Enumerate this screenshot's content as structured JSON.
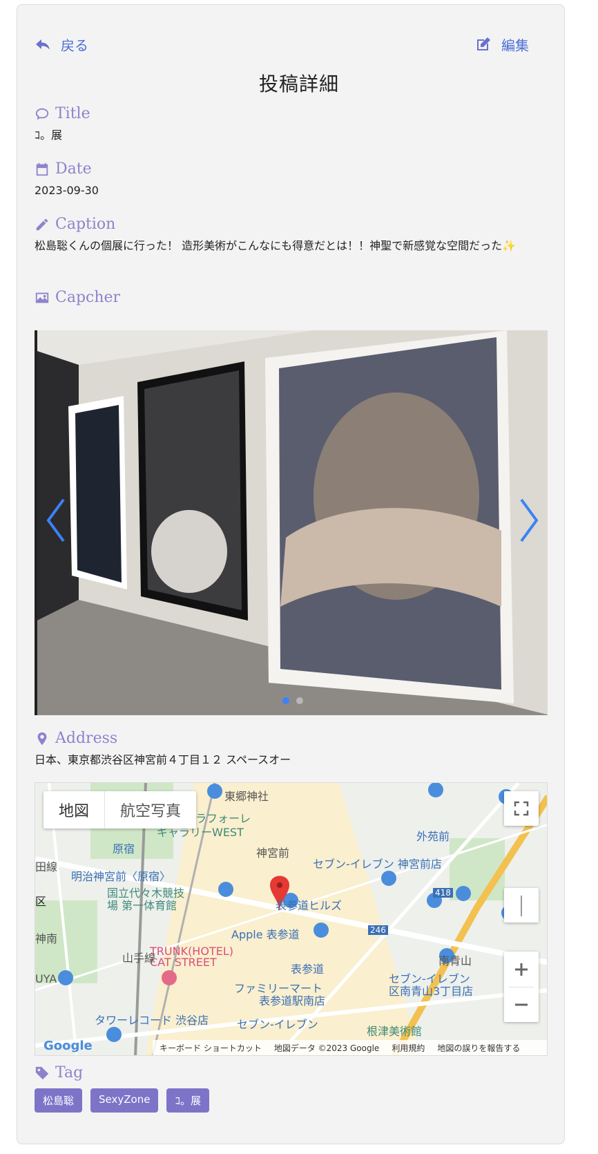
{
  "nav": {
    "back_label": "戻る",
    "edit_label": "編集"
  },
  "page_title": "投稿詳細",
  "title_section": {
    "label": "Title",
    "value": "ｺ。展"
  },
  "date_section": {
    "label": "Date",
    "value": "2023-09-30"
  },
  "caption_section": {
    "label": "Caption",
    "value": "松島聡くんの個展に行った！ 造形美術がこんなにも得意だとは！！神聖で新感覚な空間だった✨"
  },
  "capture_section": {
    "label": "Capcher",
    "slide_count": 2,
    "active_slide": 1
  },
  "address_section": {
    "label": "Address",
    "value": "日本、東京都渋谷区神宮前４丁目１２ スペースオー"
  },
  "map": {
    "type_map": "地図",
    "type_satellite": "航空写真",
    "labels": {
      "togo_shrine": "東郷神社",
      "laforet": "ラフォーレ",
      "gallery": "ギャラリーWEST",
      "harajuku": "原宿",
      "jingumae": "神宮前",
      "gaienmae": "外苑前",
      "meiji": "明治神宮前〈原宿〉",
      "seven1": "セブン-イレブン 神宮前店",
      "yoyogi1": "国立代々木競技",
      "yoyogi2": "場 第一体育館",
      "omotesando_hills": "表参道ヒルズ",
      "apple": "Apple 表参道",
      "trunk1": "TRUNK(HOTEL)",
      "trunk2": "CAT STREET",
      "omotesando": "表参道",
      "minami_aoyama": "南青山",
      "familymart1": "ファミリーマート",
      "familymart2": "表参道駅南店",
      "seven2a": "セブン-イレブン",
      "seven2b": "区南青山3丁目店",
      "tower": "タワーレコード 渋谷店",
      "seven3": "セブン-イレブン",
      "nezu": "根津美術館",
      "yamanote": "山手線",
      "tanuki": "田線",
      "ku": "区",
      "jinnan": "神南",
      "uya": "UYA",
      "road418": "418",
      "road246": "246"
    },
    "footer_keyboard": "キーボード ショートカット",
    "footer_data": "地図データ ©2023 Google",
    "footer_terms": "利用規約",
    "footer_report": "地図の誤りを報告する",
    "logo": "Google"
  },
  "tag_section": {
    "label": "Tag",
    "tags": [
      "松島聡",
      "SexyZone",
      "ｺ。展"
    ]
  },
  "colors": {
    "accent": "#8d83cc",
    "link": "#4b6fd6",
    "tag_bg": "#7d74c8",
    "dot_active": "#3b82f6"
  }
}
